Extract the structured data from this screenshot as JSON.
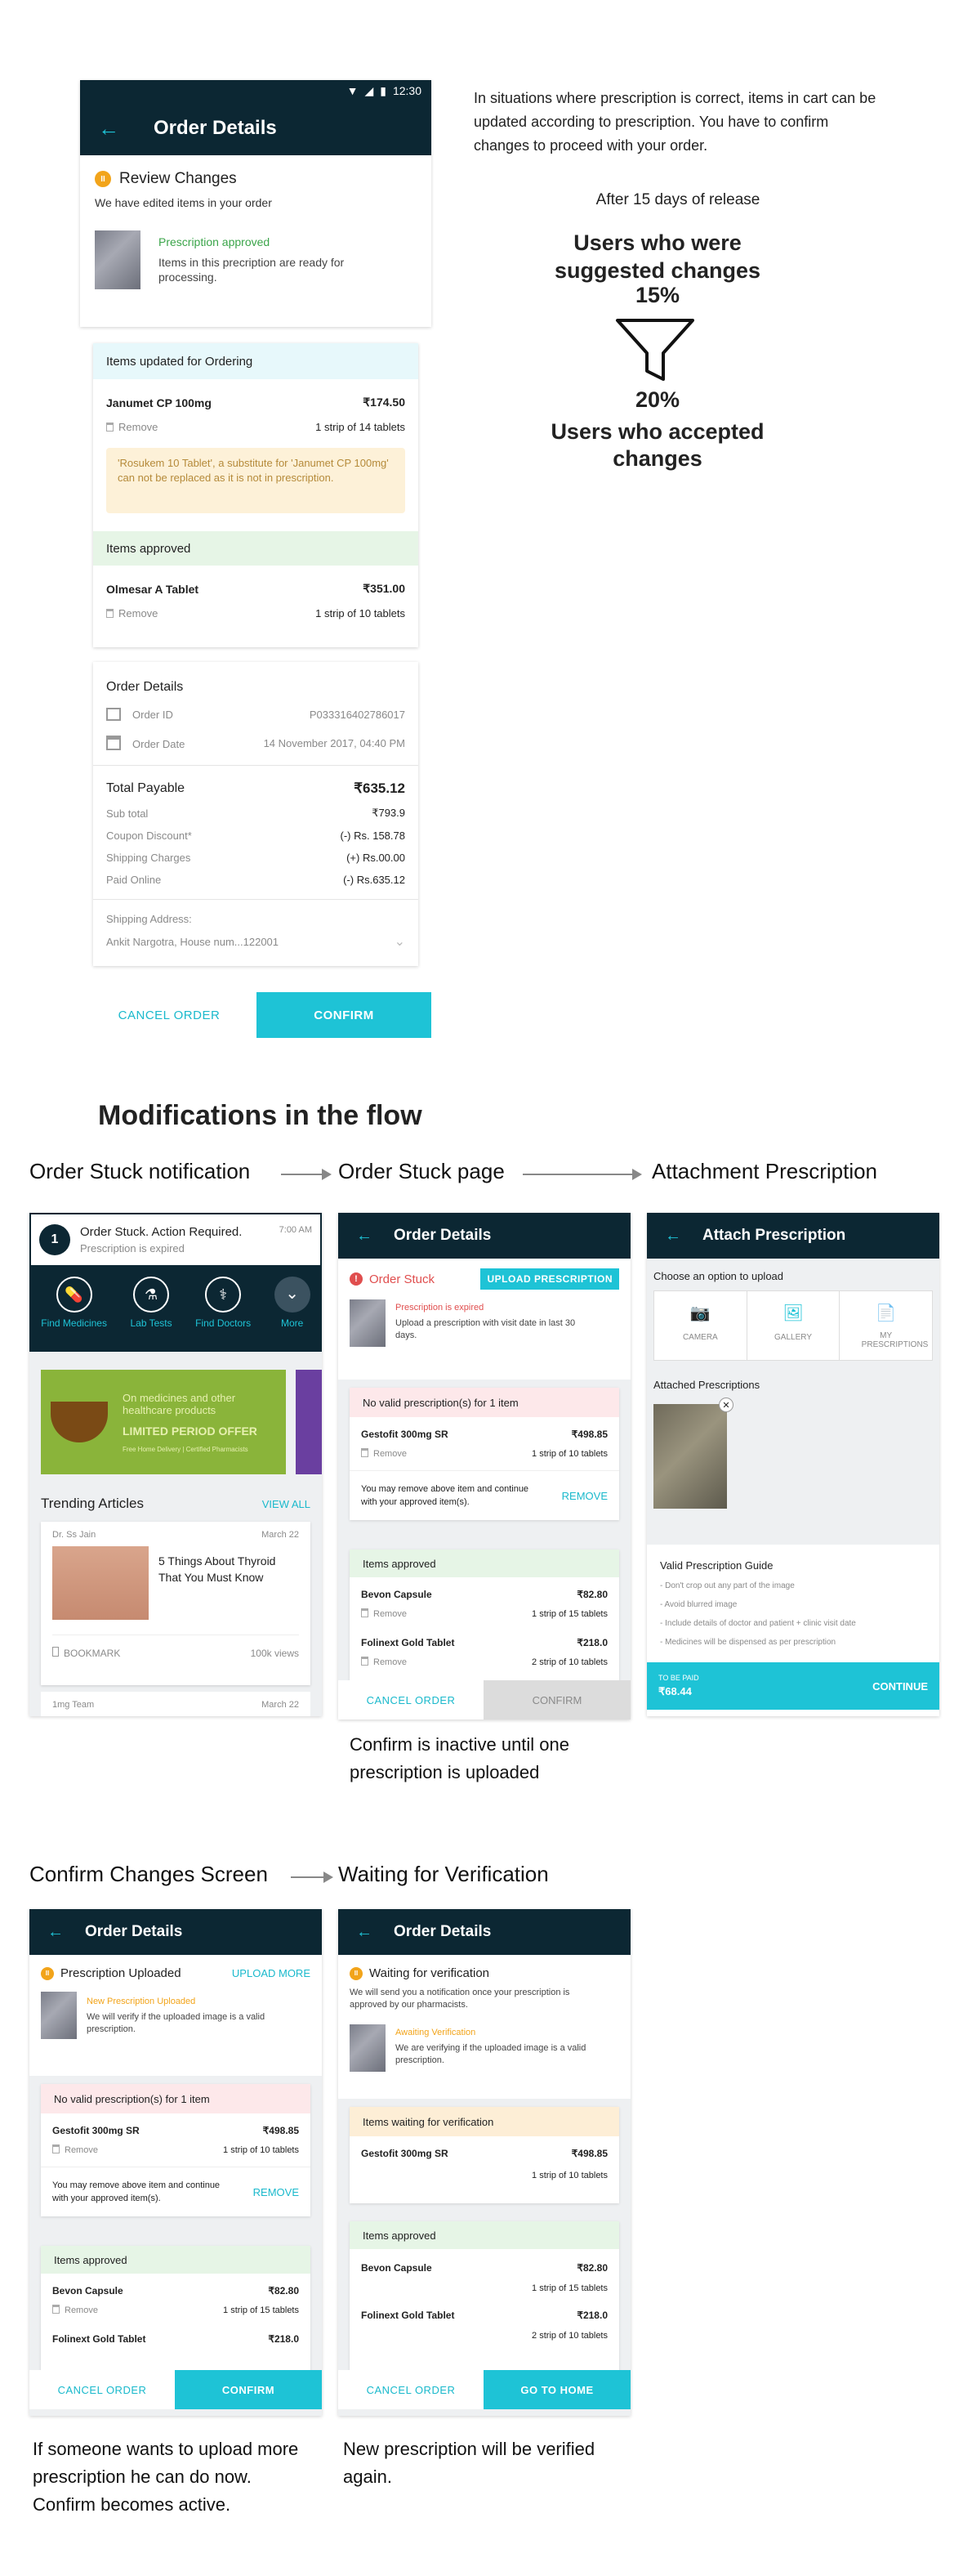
{
  "s1": {
    "status_time": "12:30",
    "title": "Order Details",
    "review": {
      "title": "Review Changes",
      "desc": "We have edited items in your order",
      "approved": "Prescription approved",
      "approved_desc": "Items in this precription are ready for processing."
    },
    "updated_header": "Items updated for Ordering",
    "item1": {
      "name": "Janumet CP 100mg",
      "price": "₹174.50",
      "remove": "Remove",
      "qty": "1 strip of 14 tablets"
    },
    "warning": "'Rosukem 10 Tablet', a substitute for 'Janumet CP 100mg' can not be replaced as it is not in prescription.",
    "approved_header": "Items approved",
    "item2": {
      "name": "Olmesar A Tablet",
      "price": "₹351.00",
      "remove": "Remove",
      "qty": "1 strip of 10 tablets"
    },
    "od": {
      "title": "Order Details",
      "order_id_label": "Order ID",
      "order_id": "P033316402786017",
      "date_label": "Order Date",
      "date": "14 November 2017, 04:40 PM"
    },
    "totals": {
      "payable_label": "Total Payable",
      "payable": "₹635.12",
      "subtotal_label": "Sub total",
      "subtotal": "₹793.9",
      "coupon_label": "Coupon Discount*",
      "coupon": "(-) Rs. 158.78",
      "shipping_label": "Shipping Charges",
      "shipping": "(+) Rs.00.00",
      "paid_label": "Paid Online",
      "paid": "(-) Rs.635.12"
    },
    "address_label": "Shipping Address:",
    "address": "Ankit Nargotra, House num...122001",
    "cancel": "CANCEL ORDER",
    "confirm": "CONFIRM"
  },
  "stats": {
    "intro": "In situations where prescription is correct, items in cart can be updated according to prescription. You have to confirm changes to proceed with your order.",
    "after": "After 15 days of release",
    "suggested": "Users who were suggested changes",
    "pct1": "15%",
    "pct2": "20%",
    "accepted": "Users who accepted changes"
  },
  "sec2": {
    "title": "Modifications in the flow",
    "h1": "Order Stuck notification",
    "h2": "Order Stuck page",
    "h3": "Attachment Prescription"
  },
  "notif": {
    "title": "Order Stuck. Action Required.",
    "time": "7:00 AM",
    "sub": "Prescription is expired",
    "cats": [
      "Find Medicines",
      "Lab Tests",
      "Find Doctors",
      "More"
    ],
    "banner1": "On medicines and other healthcare products",
    "banner2": "LIMITED PERIOD OFFER",
    "banner3": "Free Home Delivery | Certified Pharmacists",
    "trending": "Trending Articles",
    "view_all": "VIEW ALL",
    "author": "Dr. Ss Jain",
    "date": "March 22",
    "article": "5 Things About Thyroid That You Must Know",
    "bookmark": "BOOKMARK",
    "views": "100k views",
    "author2": "1mg Team",
    "date2": "March 22"
  },
  "stuck": {
    "title": "Order Details",
    "label": "Order Stuck",
    "upload": "UPLOAD PRESCRIPTION",
    "expired": "Prescription is expired",
    "expired_desc": "Upload a prescription with visit date in last 30 days.",
    "novalid": "No valid prescription(s) for 1 item",
    "item": {
      "name": "Gestofit 300mg SR",
      "price": "₹498.85",
      "remove": "Remove",
      "qty": "1 strip of 10 tablets"
    },
    "remove_msg": "You may remove above item and continue with your approved item(s).",
    "remove_btn": "REMOVE",
    "approved": "Items approved",
    "a1": {
      "name": "Bevon Capsule",
      "price": "₹82.80",
      "remove": "Remove",
      "qty": "1 strip of 15 tablets"
    },
    "a2": {
      "name": "Folinext Gold Tablet",
      "price": "₹218.0",
      "remove": "Remove",
      "qty": "2 strip of 10 tablets"
    },
    "cancel": "CANCEL ORDER",
    "confirm": "CONFIRM"
  },
  "attach": {
    "title": "Attach Prescription",
    "choose": "Choose an option to upload",
    "opts": [
      "CAMERA",
      "GALLERY",
      "MY PRESCRIPTIONS"
    ],
    "attached": "Attached Prescriptions",
    "guide": "Valid Prescription Guide",
    "rules": [
      "- Don't crop out any part of the image",
      "- Avoid blurred image",
      "- Include details of doctor and patient + clinic visit date",
      "- Medicines will be dispensed as per prescription"
    ],
    "to_pay_label": "TO BE PAID",
    "to_pay": "₹68.44",
    "continue": "CONTINUE"
  },
  "note1": "Confirm is inactive until one prescription is uploaded",
  "sec3": {
    "h1": "Confirm Changes Screen",
    "h2": "Waiting for Verification"
  },
  "confirm": {
    "title": "Order Details",
    "uploaded": "Prescription Uploaded",
    "upload_more": "UPLOAD MORE",
    "new": "New Prescription Uploaded",
    "new_desc": "We will verify if the uploaded image is a valid prescription.",
    "novalid": "No valid prescription(s) for 1 item",
    "item": {
      "name": "Gestofit 300mg SR",
      "price": "₹498.85",
      "remove": "Remove",
      "qty": "1 strip of 10 tablets"
    },
    "remove_msg": "You may remove above item and continue with your approved item(s).",
    "remove_btn": "REMOVE",
    "approved": "Items approved",
    "a1": {
      "name": "Bevon Capsule",
      "price": "₹82.80",
      "remove": "Remove",
      "qty": "1 strip of 15 tablets"
    },
    "a2": {
      "name": "Folinext Gold Tablet",
      "price": "₹218.0"
    },
    "cancel": "CANCEL ORDER",
    "confirm": "CONFIRM"
  },
  "waiting": {
    "title": "Order Details",
    "label": "Waiting for verification",
    "desc": "We will send you a notification once your prescription is approved by our pharmacists.",
    "awaiting": "Awaiting Verification",
    "awaiting_desc": "We are verifying if the uploaded image is a valid prescription.",
    "waiting_hdr": "Items waiting for verification",
    "item": {
      "name": "Gestofit 300mg SR",
      "price": "₹498.85",
      "qty": "1 strip of 10 tablets"
    },
    "approved": "Items approved",
    "a1": {
      "name": "Bevon Capsule",
      "price": "₹82.80",
      "qty": "1 strip of 15 tablets"
    },
    "a2": {
      "name": "Folinext Gold Tablet",
      "price": "₹218.0",
      "qty": "2 strip of 10 tablets"
    },
    "cancel": "CANCEL ORDER",
    "home": "GO TO HOME"
  },
  "note2": "If someone wants to upload more prescription he can do now. Confirm becomes active.",
  "note3": "New prescription will be verified again."
}
